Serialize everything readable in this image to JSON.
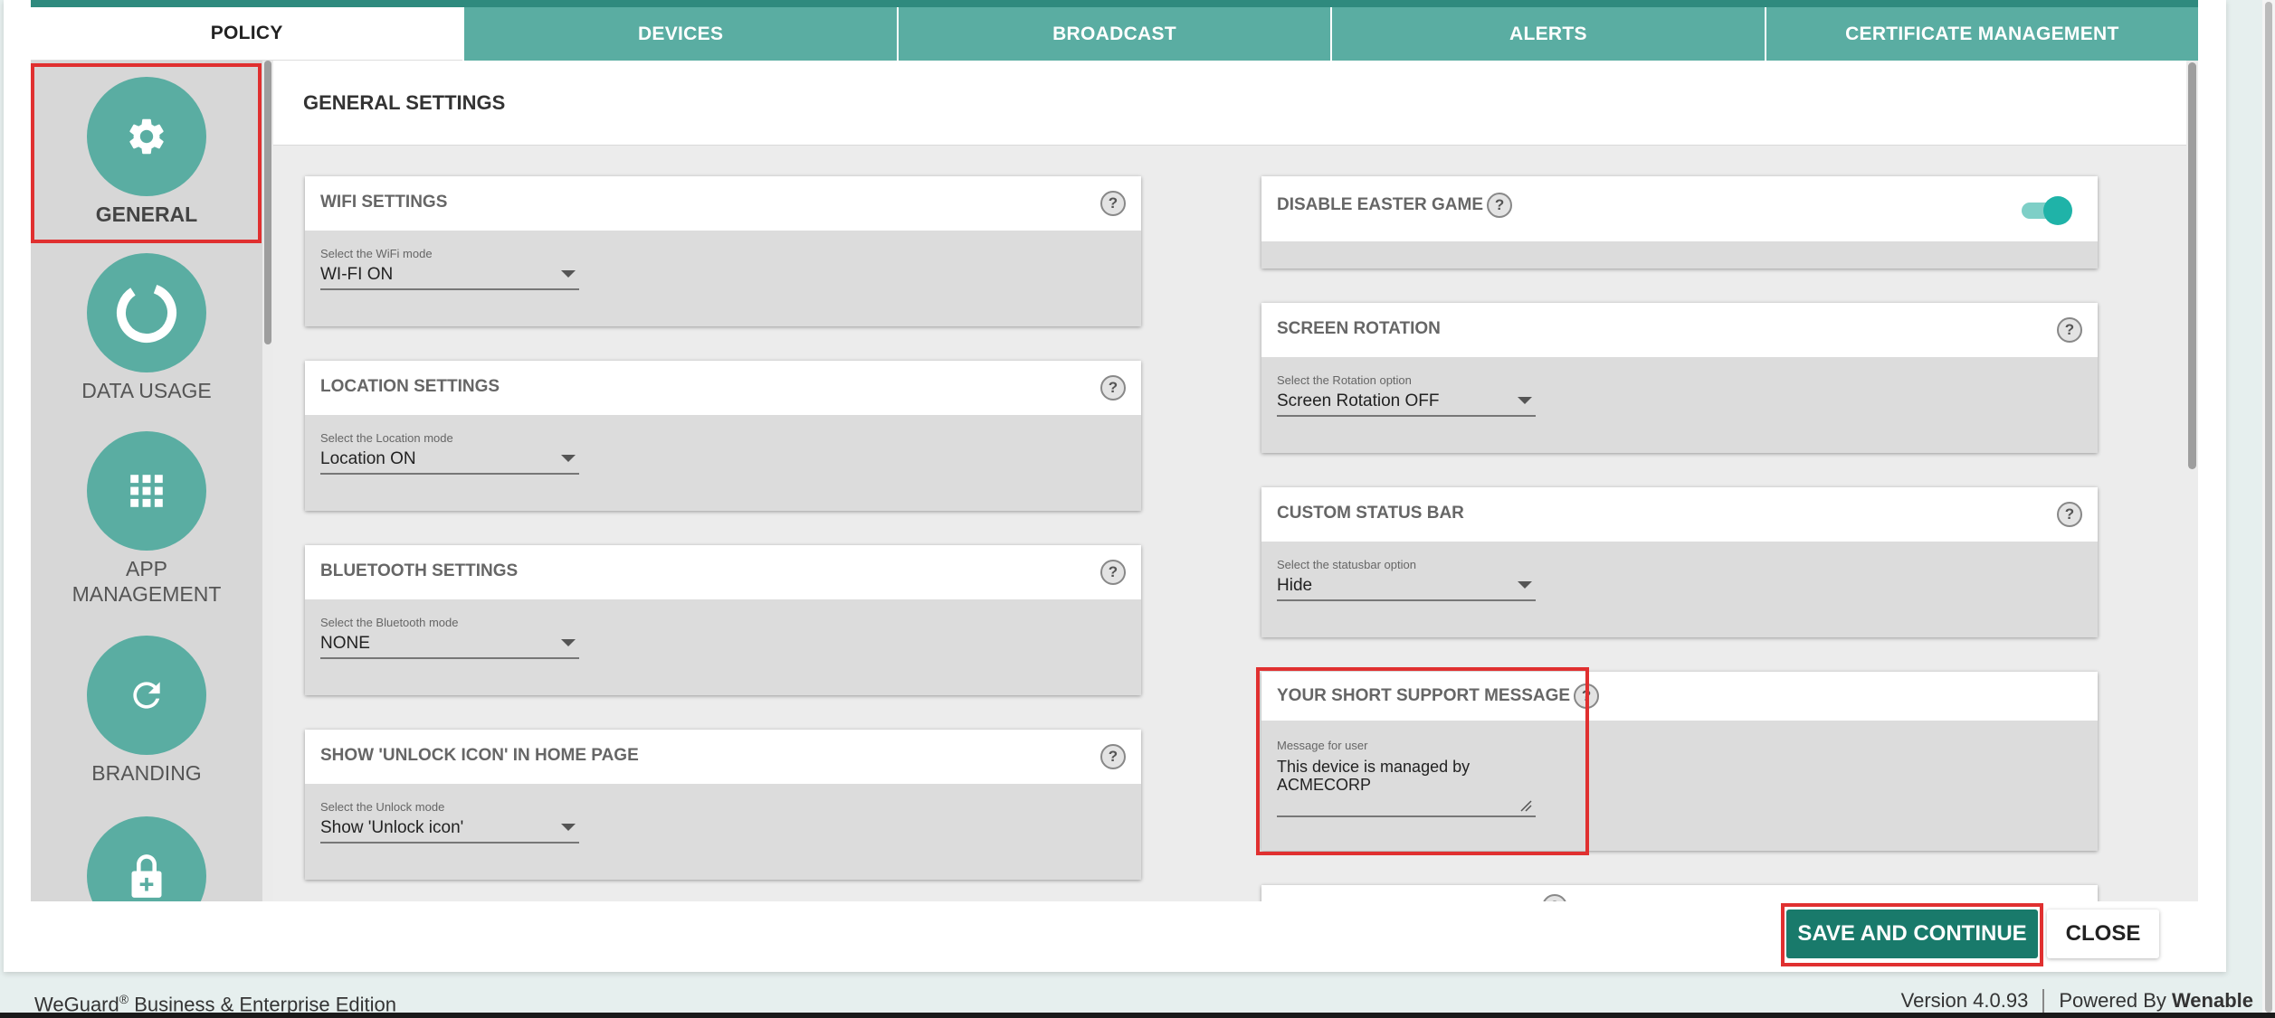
{
  "tabs": [
    {
      "label": "POLICY",
      "active": true
    },
    {
      "label": "DEVICES"
    },
    {
      "label": "BROADCAST"
    },
    {
      "label": "ALERTS"
    },
    {
      "label": "CERTIFICATE MANAGEMENT"
    }
  ],
  "sidebar": {
    "items": [
      {
        "label": "GENERAL",
        "icon": "gear-icon",
        "selected": true
      },
      {
        "label": "DATA USAGE",
        "icon": "donut-chart-icon"
      },
      {
        "label": "APP\nMANAGEMENT",
        "label_line1": "APP",
        "label_line2": "MANAGEMENT",
        "icon": "grid-icon"
      },
      {
        "label": "BRANDING",
        "icon": "refresh-icon"
      },
      {
        "label": "",
        "icon": "lock-plus-icon"
      }
    ]
  },
  "main": {
    "title": "GENERAL SETTINGS",
    "cards": {
      "wifi": {
        "title": "WIFI SETTINGS",
        "field_label": "Select the WiFi mode",
        "value": "WI-FI ON"
      },
      "location": {
        "title": "LOCATION SETTINGS",
        "field_label": "Select the Location mode",
        "value": "Location ON"
      },
      "bluetooth": {
        "title": "BLUETOOTH SETTINGS",
        "field_label": "Select the Bluetooth mode",
        "value": "NONE"
      },
      "unlock": {
        "title": "SHOW 'UNLOCK ICON' IN HOME PAGE",
        "field_label": "Select the Unlock mode",
        "value": "Show 'Unlock icon'"
      },
      "easter": {
        "title": "DISABLE EASTER GAME",
        "toggle_on": true
      },
      "rotation": {
        "title": "SCREEN ROTATION",
        "field_label": "Select the Rotation option",
        "value": "Screen Rotation OFF"
      },
      "statusbar": {
        "title": "CUSTOM STATUS BAR",
        "field_label": "Select the statusbar option",
        "value": "Hide"
      },
      "support": {
        "title": "YOUR SHORT SUPPORT MESSAGE",
        "field_label": "Message for user",
        "value": "This device is managed by ACMECORP"
      }
    },
    "help_glyph": "?"
  },
  "actions": {
    "save_label": "SAVE AND CONTINUE",
    "close_label": "CLOSE"
  },
  "footer": {
    "product": "WeGuard",
    "trademark": "®",
    "edition": " Business & Enterprise Edition",
    "version": "Version 4.0.93",
    "powered_by": "Powered By",
    "brand": "Wenable"
  },
  "colors": {
    "accent": "#5aada2",
    "accent_dark": "#197a6b",
    "highlight": "#e03030"
  }
}
